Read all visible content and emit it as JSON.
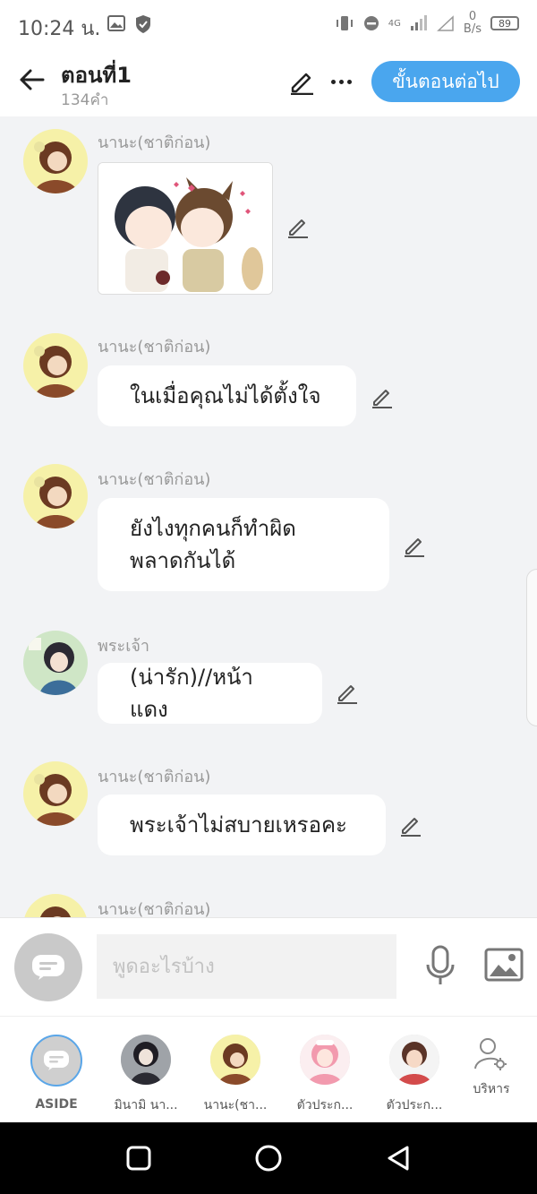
{
  "status_bar": {
    "time": "10:24 น.",
    "net_speed_value": "0",
    "net_speed_unit": "B/s",
    "network_type": "4G",
    "battery": "89"
  },
  "header": {
    "title": "ตอนที่1",
    "subtitle": "134คำ",
    "next_button": "ขั้นตอนต่อไป"
  },
  "messages": [
    {
      "sender": "นานะ(ชาติก่อน)",
      "text": "",
      "type": "image"
    },
    {
      "sender": "นานะ(ชาติก่อน)",
      "text": "ในเมื่อคุณไม่ได้ตั้งใจ",
      "type": "text"
    },
    {
      "sender": "นานะ(ชาติก่อน)",
      "text": "ยังไงทุกคนก็ทำผิดพลาดกันได้",
      "line1": "ยังไงทุกคนก็ทำผิด",
      "line2": "พลาดกันได้",
      "type": "text"
    },
    {
      "sender": "พระเจ้า",
      "text": "(น่ารัก)//หน้าแดง",
      "type": "text"
    },
    {
      "sender": "นานะ(ชาติก่อน)",
      "text": "พระเจ้าไม่สบายเหรอคะ",
      "type": "text"
    },
    {
      "sender": "นานะ(ชาติก่อน)",
      "text": "",
      "type": "partial"
    }
  ],
  "input_bar": {
    "placeholder": "พูดอะไรบ้าง"
  },
  "characters": [
    {
      "name": "ASIDE"
    },
    {
      "name": "มินามิ นา..."
    },
    {
      "name": "นานะ(ชา..."
    },
    {
      "name": "ตัวประก..."
    },
    {
      "name": "ตัวประก..."
    },
    {
      "name": "บริหาร"
    }
  ],
  "colors": {
    "accent": "#4aa6ee",
    "background": "#f2f3f5",
    "bubble": "#ffffff",
    "aside_ring": "#5aa6e8"
  },
  "icons": [
    "back-arrow-icon",
    "pencil-icon",
    "more-dots-icon",
    "mic-icon",
    "image-icon",
    "chat-bubble-icon",
    "manage-user-icon",
    "nav-square-icon",
    "nav-circle-icon",
    "nav-triangle-icon"
  ]
}
